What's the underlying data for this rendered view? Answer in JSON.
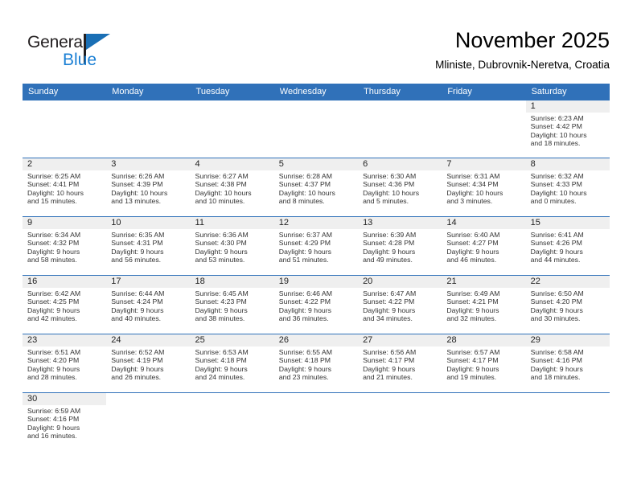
{
  "brand": {
    "word1": "General",
    "word2": "Blue"
  },
  "header": {
    "title": "November 2025",
    "subtitle": "Mliniste, Dubrovnik-Neretva, Croatia"
  },
  "colors": {
    "header_blue": "#3071b9",
    "brand_blue": "#1a7fd4",
    "date_band": "#efefef"
  },
  "weekdays": [
    "Sunday",
    "Monday",
    "Tuesday",
    "Wednesday",
    "Thursday",
    "Friday",
    "Saturday"
  ],
  "weeks": [
    [
      {
        "date": "",
        "sunrise": "",
        "sunset": "",
        "daylight1": "",
        "daylight2": ""
      },
      {
        "date": "",
        "sunrise": "",
        "sunset": "",
        "daylight1": "",
        "daylight2": ""
      },
      {
        "date": "",
        "sunrise": "",
        "sunset": "",
        "daylight1": "",
        "daylight2": ""
      },
      {
        "date": "",
        "sunrise": "",
        "sunset": "",
        "daylight1": "",
        "daylight2": ""
      },
      {
        "date": "",
        "sunrise": "",
        "sunset": "",
        "daylight1": "",
        "daylight2": ""
      },
      {
        "date": "",
        "sunrise": "",
        "sunset": "",
        "daylight1": "",
        "daylight2": ""
      },
      {
        "date": "1",
        "sunrise": "Sunrise: 6:23 AM",
        "sunset": "Sunset: 4:42 PM",
        "daylight1": "Daylight: 10 hours",
        "daylight2": "and 18 minutes."
      }
    ],
    [
      {
        "date": "2",
        "sunrise": "Sunrise: 6:25 AM",
        "sunset": "Sunset: 4:41 PM",
        "daylight1": "Daylight: 10 hours",
        "daylight2": "and 15 minutes."
      },
      {
        "date": "3",
        "sunrise": "Sunrise: 6:26 AM",
        "sunset": "Sunset: 4:39 PM",
        "daylight1": "Daylight: 10 hours",
        "daylight2": "and 13 minutes."
      },
      {
        "date": "4",
        "sunrise": "Sunrise: 6:27 AM",
        "sunset": "Sunset: 4:38 PM",
        "daylight1": "Daylight: 10 hours",
        "daylight2": "and 10 minutes."
      },
      {
        "date": "5",
        "sunrise": "Sunrise: 6:28 AM",
        "sunset": "Sunset: 4:37 PM",
        "daylight1": "Daylight: 10 hours",
        "daylight2": "and 8 minutes."
      },
      {
        "date": "6",
        "sunrise": "Sunrise: 6:30 AM",
        "sunset": "Sunset: 4:36 PM",
        "daylight1": "Daylight: 10 hours",
        "daylight2": "and 5 minutes."
      },
      {
        "date": "7",
        "sunrise": "Sunrise: 6:31 AM",
        "sunset": "Sunset: 4:34 PM",
        "daylight1": "Daylight: 10 hours",
        "daylight2": "and 3 minutes."
      },
      {
        "date": "8",
        "sunrise": "Sunrise: 6:32 AM",
        "sunset": "Sunset: 4:33 PM",
        "daylight1": "Daylight: 10 hours",
        "daylight2": "and 0 minutes."
      }
    ],
    [
      {
        "date": "9",
        "sunrise": "Sunrise: 6:34 AM",
        "sunset": "Sunset: 4:32 PM",
        "daylight1": "Daylight: 9 hours",
        "daylight2": "and 58 minutes."
      },
      {
        "date": "10",
        "sunrise": "Sunrise: 6:35 AM",
        "sunset": "Sunset: 4:31 PM",
        "daylight1": "Daylight: 9 hours",
        "daylight2": "and 56 minutes."
      },
      {
        "date": "11",
        "sunrise": "Sunrise: 6:36 AM",
        "sunset": "Sunset: 4:30 PM",
        "daylight1": "Daylight: 9 hours",
        "daylight2": "and 53 minutes."
      },
      {
        "date": "12",
        "sunrise": "Sunrise: 6:37 AM",
        "sunset": "Sunset: 4:29 PM",
        "daylight1": "Daylight: 9 hours",
        "daylight2": "and 51 minutes."
      },
      {
        "date": "13",
        "sunrise": "Sunrise: 6:39 AM",
        "sunset": "Sunset: 4:28 PM",
        "daylight1": "Daylight: 9 hours",
        "daylight2": "and 49 minutes."
      },
      {
        "date": "14",
        "sunrise": "Sunrise: 6:40 AM",
        "sunset": "Sunset: 4:27 PM",
        "daylight1": "Daylight: 9 hours",
        "daylight2": "and 46 minutes."
      },
      {
        "date": "15",
        "sunrise": "Sunrise: 6:41 AM",
        "sunset": "Sunset: 4:26 PM",
        "daylight1": "Daylight: 9 hours",
        "daylight2": "and 44 minutes."
      }
    ],
    [
      {
        "date": "16",
        "sunrise": "Sunrise: 6:42 AM",
        "sunset": "Sunset: 4:25 PM",
        "daylight1": "Daylight: 9 hours",
        "daylight2": "and 42 minutes."
      },
      {
        "date": "17",
        "sunrise": "Sunrise: 6:44 AM",
        "sunset": "Sunset: 4:24 PM",
        "daylight1": "Daylight: 9 hours",
        "daylight2": "and 40 minutes."
      },
      {
        "date": "18",
        "sunrise": "Sunrise: 6:45 AM",
        "sunset": "Sunset: 4:23 PM",
        "daylight1": "Daylight: 9 hours",
        "daylight2": "and 38 minutes."
      },
      {
        "date": "19",
        "sunrise": "Sunrise: 6:46 AM",
        "sunset": "Sunset: 4:22 PM",
        "daylight1": "Daylight: 9 hours",
        "daylight2": "and 36 minutes."
      },
      {
        "date": "20",
        "sunrise": "Sunrise: 6:47 AM",
        "sunset": "Sunset: 4:22 PM",
        "daylight1": "Daylight: 9 hours",
        "daylight2": "and 34 minutes."
      },
      {
        "date": "21",
        "sunrise": "Sunrise: 6:49 AM",
        "sunset": "Sunset: 4:21 PM",
        "daylight1": "Daylight: 9 hours",
        "daylight2": "and 32 minutes."
      },
      {
        "date": "22",
        "sunrise": "Sunrise: 6:50 AM",
        "sunset": "Sunset: 4:20 PM",
        "daylight1": "Daylight: 9 hours",
        "daylight2": "and 30 minutes."
      }
    ],
    [
      {
        "date": "23",
        "sunrise": "Sunrise: 6:51 AM",
        "sunset": "Sunset: 4:20 PM",
        "daylight1": "Daylight: 9 hours",
        "daylight2": "and 28 minutes."
      },
      {
        "date": "24",
        "sunrise": "Sunrise: 6:52 AM",
        "sunset": "Sunset: 4:19 PM",
        "daylight1": "Daylight: 9 hours",
        "daylight2": "and 26 minutes."
      },
      {
        "date": "25",
        "sunrise": "Sunrise: 6:53 AM",
        "sunset": "Sunset: 4:18 PM",
        "daylight1": "Daylight: 9 hours",
        "daylight2": "and 24 minutes."
      },
      {
        "date": "26",
        "sunrise": "Sunrise: 6:55 AM",
        "sunset": "Sunset: 4:18 PM",
        "daylight1": "Daylight: 9 hours",
        "daylight2": "and 23 minutes."
      },
      {
        "date": "27",
        "sunrise": "Sunrise: 6:56 AM",
        "sunset": "Sunset: 4:17 PM",
        "daylight1": "Daylight: 9 hours",
        "daylight2": "and 21 minutes."
      },
      {
        "date": "28",
        "sunrise": "Sunrise: 6:57 AM",
        "sunset": "Sunset: 4:17 PM",
        "daylight1": "Daylight: 9 hours",
        "daylight2": "and 19 minutes."
      },
      {
        "date": "29",
        "sunrise": "Sunrise: 6:58 AM",
        "sunset": "Sunset: 4:16 PM",
        "daylight1": "Daylight: 9 hours",
        "daylight2": "and 18 minutes."
      }
    ],
    [
      {
        "date": "30",
        "sunrise": "Sunrise: 6:59 AM",
        "sunset": "Sunset: 4:16 PM",
        "daylight1": "Daylight: 9 hours",
        "daylight2": "and 16 minutes."
      },
      {
        "date": "",
        "sunrise": "",
        "sunset": "",
        "daylight1": "",
        "daylight2": ""
      },
      {
        "date": "",
        "sunrise": "",
        "sunset": "",
        "daylight1": "",
        "daylight2": ""
      },
      {
        "date": "",
        "sunrise": "",
        "sunset": "",
        "daylight1": "",
        "daylight2": ""
      },
      {
        "date": "",
        "sunrise": "",
        "sunset": "",
        "daylight1": "",
        "daylight2": ""
      },
      {
        "date": "",
        "sunrise": "",
        "sunset": "",
        "daylight1": "",
        "daylight2": ""
      },
      {
        "date": "",
        "sunrise": "",
        "sunset": "",
        "daylight1": "",
        "daylight2": ""
      }
    ]
  ]
}
